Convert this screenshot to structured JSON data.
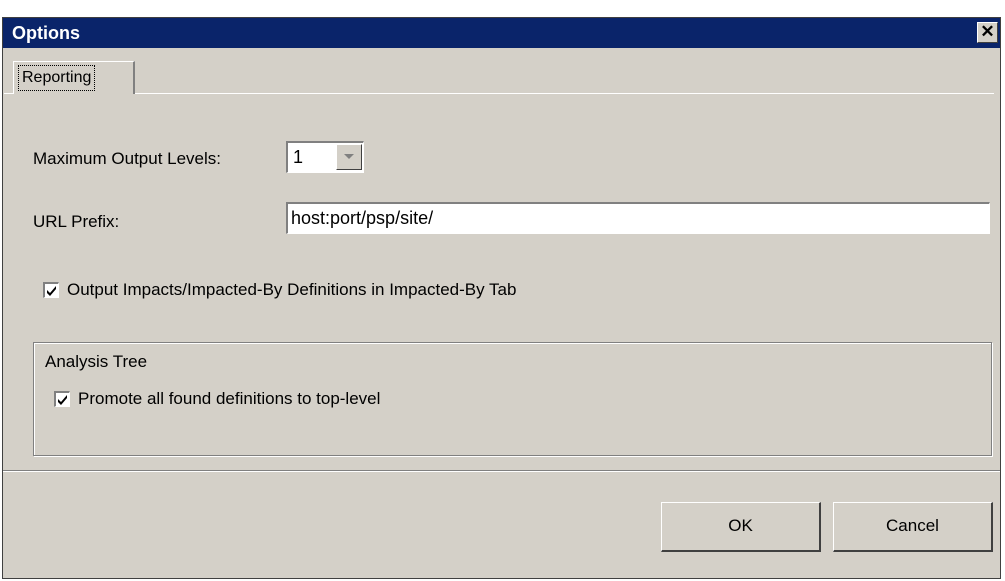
{
  "window": {
    "title": "Options",
    "close_glyph": "✕"
  },
  "tabs": [
    {
      "label": "Reporting",
      "selected": true
    }
  ],
  "form": {
    "max_levels_label": "Maximum Output Levels:",
    "max_levels_value": "1",
    "url_prefix_label": "URL Prefix:",
    "url_prefix_value": "host:port/psp/site/",
    "output_impacts_label": "Output Impacts/Impacted-By Definitions in Impacted-By Tab",
    "output_impacts_checked": true
  },
  "analysis_tree": {
    "legend": "Analysis Tree",
    "promote_label": "Promote all found definitions to top-level",
    "promote_checked": true
  },
  "buttons": {
    "ok": "OK",
    "cancel": "Cancel"
  },
  "colors": {
    "titlebar": "#0a246a",
    "face": "#d4d0c8"
  }
}
